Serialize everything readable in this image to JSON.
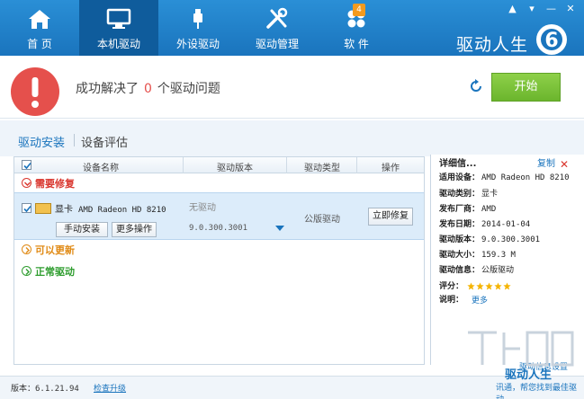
{
  "window": {
    "brand": "驱动人生",
    "brand_version_glyph": "6",
    "controls": [
      "minimize",
      "skin",
      "maximize",
      "close"
    ]
  },
  "nav": {
    "items": [
      {
        "label": "首 页",
        "icon": "home-icon"
      },
      {
        "label": "本机驱动",
        "icon": "monitor-icon",
        "active": true
      },
      {
        "label": "外设驱动",
        "icon": "usb-icon"
      },
      {
        "label": "驱动管理",
        "icon": "tools-icon"
      },
      {
        "label": "软 件",
        "icon": "apps-icon",
        "badge": "4"
      }
    ]
  },
  "status": {
    "prefix": "成功解决了",
    "count": "0",
    "suffix": "个驱动问题",
    "start_label": "开始"
  },
  "subtabs": {
    "install": "驱动安装",
    "evaluate": "设备评估"
  },
  "table": {
    "headers": [
      "设备名称",
      "驱动版本",
      "驱动类型",
      "操作"
    ],
    "groups": {
      "need_fix": "需要修复",
      "updatable": "可以更新",
      "normal": "正常驱动"
    },
    "row": {
      "category": "显卡",
      "model": "AMD Radeon HD 8210",
      "no_driver": "无驱动",
      "version": "9.0.300.3001",
      "driver_type": "公版驱动",
      "fix_now": "立即修复",
      "manual_install": "手动安装",
      "more_ops": "更多操作"
    }
  },
  "details": {
    "title": "详细信...",
    "copy": "复制",
    "rows": [
      {
        "k": "适用设备：",
        "v": "AMD Radeon HD 8210"
      },
      {
        "k": "驱动类别：",
        "v": "显卡"
      },
      {
        "k": "发布厂商：",
        "v": "AMD"
      },
      {
        "k": "发布日期：",
        "v": "2014-01-04"
      },
      {
        "k": "驱动版本：",
        "v": "9.0.300.3001"
      },
      {
        "k": "驱动大小：",
        "v": "159.3 M"
      },
      {
        "k": "驱动信息：",
        "v": "公版驱动"
      }
    ],
    "rating_label": "评分：",
    "rating_stars": 5,
    "note_label": "说明：",
    "more": "更多",
    "settings_link": "驱动信息设置"
  },
  "footer": {
    "version_label": "版本：",
    "version": "6.1.21.94",
    "check_upgrade": "检查升级"
  },
  "watermark": {
    "brand": "驱动人生",
    "sub": "讯通，帮您找到最佳驱动"
  },
  "colors": {
    "nav_blue": "#1a74bd",
    "nav_active": "#0f5c9c",
    "warning_red": "#e5504c",
    "start_green": "#6bb52d",
    "badge_orange": "#f39a1e"
  }
}
